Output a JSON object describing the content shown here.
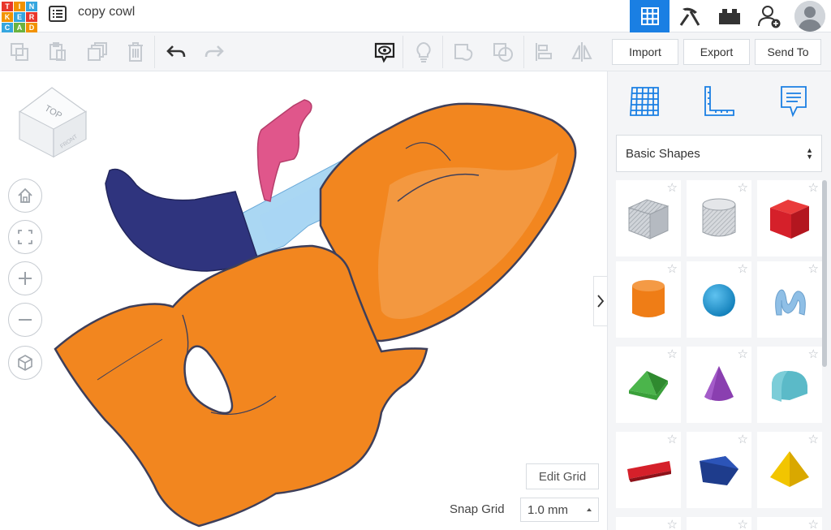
{
  "app": {
    "logo_letters": [
      "T",
      "I",
      "N",
      "K",
      "E",
      "R",
      "C",
      "A",
      "D"
    ],
    "doc_title": "copy cowl"
  },
  "header": {
    "buttons": [
      {
        "name": "3d-design-view",
        "icon": "grid-icon",
        "active": true
      },
      {
        "name": "codeblocks-view",
        "icon": "pickaxe-icon",
        "active": false
      },
      {
        "name": "bricks-view",
        "icon": "brick-icon",
        "active": false
      },
      {
        "name": "add-user",
        "icon": "add-user-icon",
        "active": false
      }
    ]
  },
  "toolbar": {
    "import_label": "Import",
    "export_label": "Export",
    "send_to_label": "Send To"
  },
  "workplane": {
    "edit_grid_label": "Edit Grid",
    "snap_grid_label": "Snap Grid",
    "snap_grid_value": "1.0 mm",
    "viewcube_top": "TOP",
    "viewcube_front": "FRONT"
  },
  "panel": {
    "category": "Basic Shapes",
    "shapes": [
      {
        "name": "box-hole",
        "color": "#b9bec5"
      },
      {
        "name": "cylinder-hole",
        "color": "#c4c8ce"
      },
      {
        "name": "box",
        "color": "#d5202a"
      },
      {
        "name": "cylinder",
        "color": "#ef7d16"
      },
      {
        "name": "sphere",
        "color": "#1b9ad6"
      },
      {
        "name": "scribble",
        "color": "#8fbfe6"
      },
      {
        "name": "roof",
        "color": "#3aa03a"
      },
      {
        "name": "cone",
        "color": "#8a3fb0"
      },
      {
        "name": "round-roof",
        "color": "#5bbac8"
      },
      {
        "name": "text",
        "color": "#d5202a"
      },
      {
        "name": "polygon",
        "color": "#1e3c8c"
      },
      {
        "name": "pyramid",
        "color": "#f2c500"
      }
    ]
  },
  "colors": {
    "accent": "#1a7fe3",
    "orange": "#f2861f",
    "navy": "#2f347e",
    "pink": "#e0568b",
    "light_blue": "#8ec9ef"
  }
}
